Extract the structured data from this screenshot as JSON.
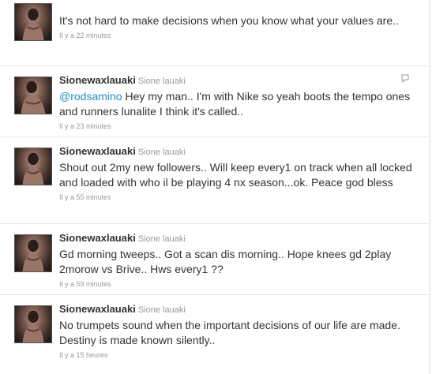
{
  "tweets": [
    {
      "screen_name": "",
      "full_name": "",
      "mention": "",
      "text": "It's not hard to make decisions when you know what your values are..",
      "time": "Il y a 22 minutes"
    },
    {
      "screen_name": "Sionewaxlauaki",
      "full_name": "Sione lauaki",
      "mention": "@rodsamino",
      "text": " Hey my man.. I'm with Nike so yeah boots the tempo ones and runners lunalite I think it's called..",
      "time": "Il y a 23 minutes"
    },
    {
      "screen_name": "Sionewaxlauaki",
      "full_name": "Sione lauaki",
      "mention": "",
      "text": "Shout out 2my new followers.. Will keep every1 on track when all locked and loaded with who il be playing 4 nx season...ok. Peace god bless",
      "time": "Il y a 55 minutes"
    },
    {
      "screen_name": "Sionewaxlauaki",
      "full_name": "Sione lauaki",
      "mention": "",
      "text": "Gd morning tweeps.. Got a scan dis morning.. Hope knees gd 2play 2morow vs Brive.. Hws every1 ??",
      "time": "Il y a 59 minutes"
    },
    {
      "screen_name": "Sionewaxlauaki",
      "full_name": "Sione lauaki",
      "mention": "",
      "text": "No trumpets sound when the important decisions of our life are made. Destiny is made known silently..",
      "time": "Il y a 15 heures"
    }
  ],
  "colors": {
    "link": "#2b8bc4",
    "text": "#333333",
    "muted": "#999999"
  },
  "icons": {
    "reply": "reply-icon",
    "avatar": "avatar"
  }
}
